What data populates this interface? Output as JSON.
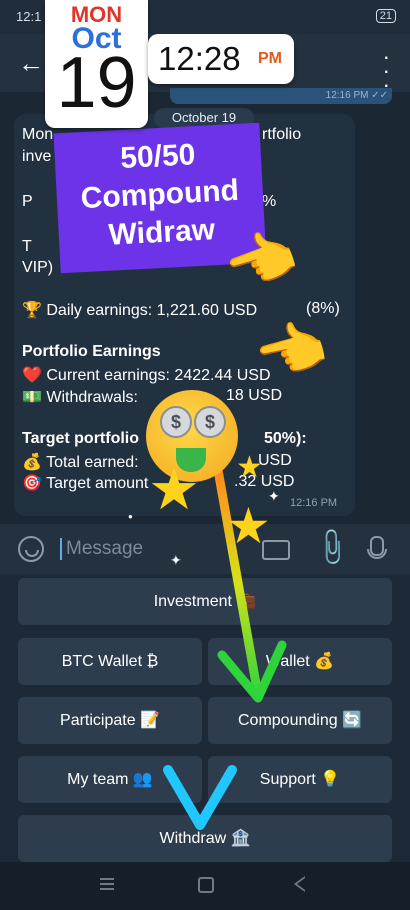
{
  "status_bar": {
    "time": "12:1",
    "battery": "21"
  },
  "overlay": {
    "calendar_day": "MON",
    "calendar_month": "Oct",
    "calendar_date": "19",
    "clock_time": "12:28",
    "clock_ampm": "PM",
    "promo_line1": "50/50",
    "promo_line2": "Compound",
    "promo_line3": "Widraw"
  },
  "chat": {
    "out_time": "12:16 PM ✓✓",
    "date_label": "October 19",
    "message": {
      "line1a": "Mon",
      "line1b": "rtfolio",
      "line2": "inve",
      "line3a": "P",
      "line3b": "%",
      "line4a": "T",
      "line5": "VIP)",
      "daily_label": "🏆 Daily earnings: 1,221.60 USD",
      "daily_pct": "(8%)",
      "portfolio_heading": "Portfolio Earnings",
      "current_earnings": "❤️ Current earnings: 2422.44 USD",
      "withdrawals_label": "💵 Withdrawals:",
      "withdrawals_value": "18 USD",
      "target_heading": "Target portfolio",
      "target_pct": "50%):",
      "total_earned": "💰 Total earned:",
      "total_earned_value": "USD",
      "target_amount": "🎯 Target amount",
      "target_amount_value": ".32 USD",
      "time": "12:16 PM"
    }
  },
  "input": {
    "placeholder": "Message"
  },
  "keyboard": {
    "investment": "Investment 💼",
    "btc_wallet": "BTC Wallet ₿",
    "usd_wallet": "Wallet 💰",
    "participate": "Participate 📝",
    "compounding": "Compounding 🔄",
    "my_team": "My team 👥",
    "support": "Support 💡",
    "withdraw": "Withdraw 🏦"
  },
  "colors": {
    "bubble": "#223140",
    "button": "#2e3d4e",
    "promo": "#6d33e8",
    "arrow_start": "#ffd400",
    "arrow_end": "#21c8ff"
  }
}
